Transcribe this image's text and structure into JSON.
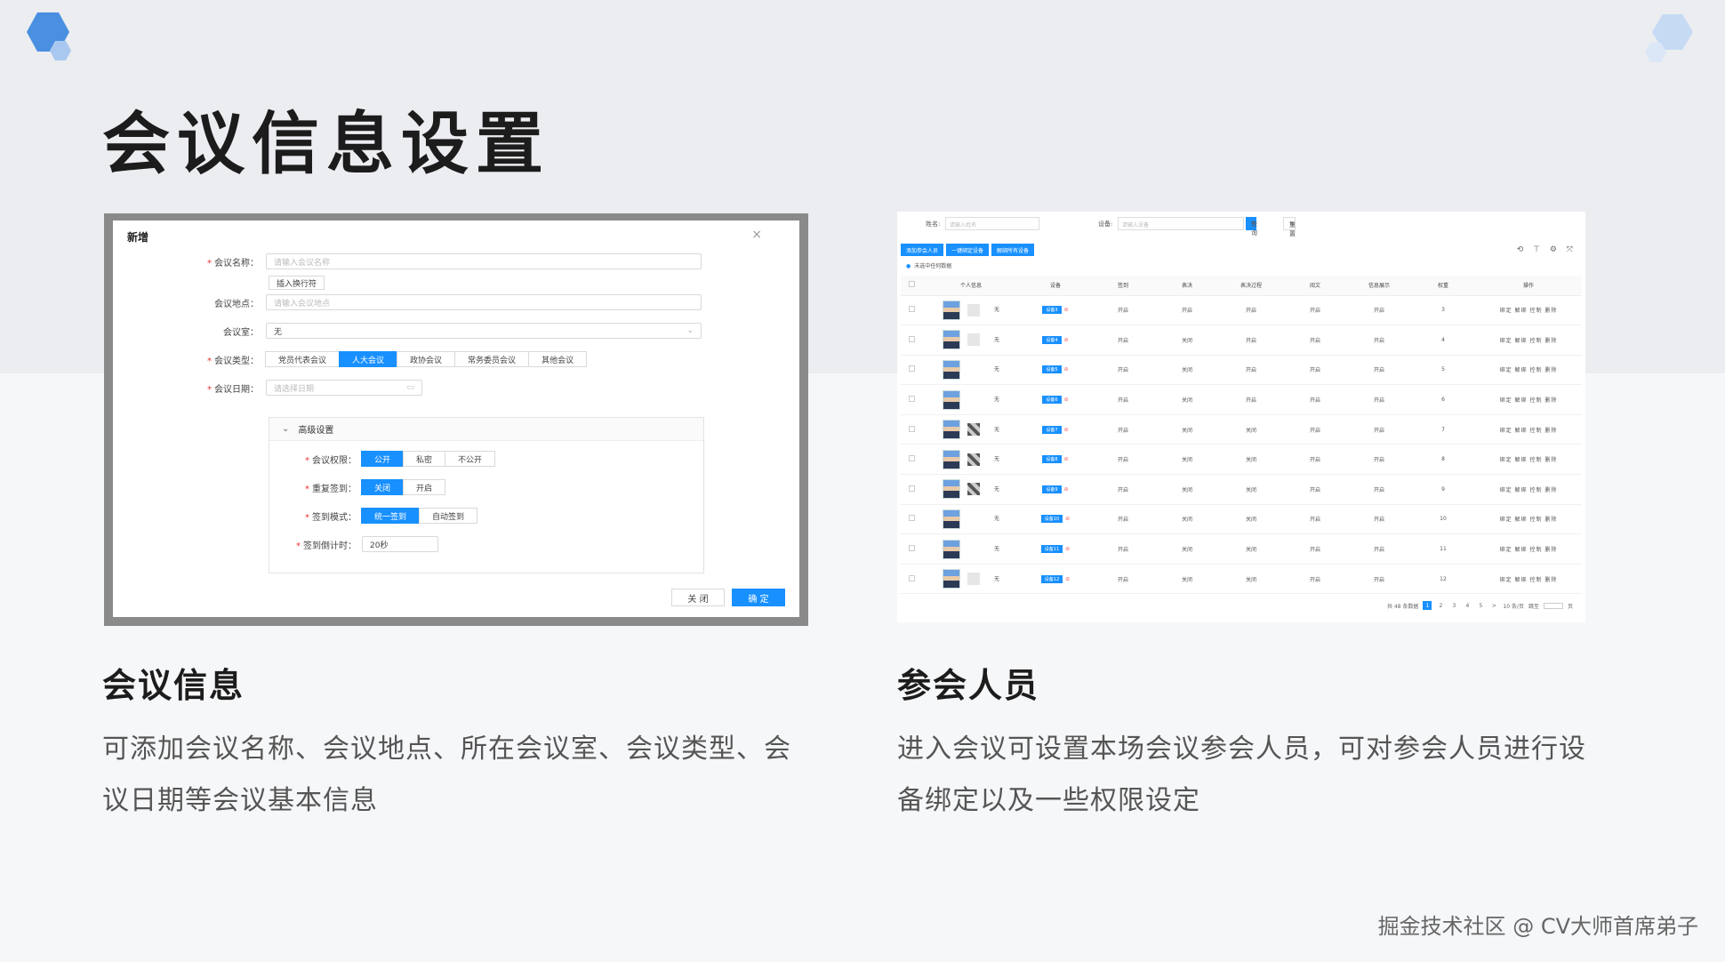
{
  "slide": {
    "title": "会议信息设置",
    "watermark": "掘金技术社区 @ CV大师首席弟子",
    "accent_color": "#4a8fe0"
  },
  "sections": [
    {
      "title": "会议信息",
      "description_line1": "可添加会议名称、会议地点、所在会议室、会议类型、会",
      "description_line2": "议日期等会议基本信息"
    },
    {
      "title": "参会人员",
      "description_line1": "进入会议可设置本场会议参会人员，可对参会人员进行设",
      "description_line2": "备绑定以及一些权限设定"
    }
  ],
  "dialog": {
    "title": "新增",
    "close_icon": "×",
    "name_label": "会议名称：",
    "name_placeholder": "请输入会议名称",
    "insert_newline": "插入换行符",
    "location_label": "会议地点：",
    "location_placeholder": "请输入会议地点",
    "room_label": "会议室：",
    "room_value": "无",
    "type_label": "会议类型：",
    "types": [
      "党员代表会议",
      "人大会议",
      "政协会议",
      "常务委员会议",
      "其他会议"
    ],
    "date_label": "会议日期：",
    "date_placeholder": "请选择日期",
    "advanced_label": "高级设置",
    "permission_label": "会议权限：",
    "permissions": [
      "公开",
      "私密",
      "不公开"
    ],
    "repeat_label": "重复签到：",
    "repeat_options": [
      "关闭",
      "开启"
    ],
    "signin_mode_label": "签到模式：",
    "signin_modes": [
      "统一签到",
      "自动签到"
    ],
    "countdown_label": "签到倒计时：",
    "countdown_value": "20秒",
    "cancel_label": "关 闭",
    "ok_label": "确 定"
  },
  "attendees": {
    "name_label": "姓名:",
    "name_placeholder": "请输入姓名",
    "device_label": "设备:",
    "device_placeholder": "请输入设备",
    "query_label": "查询",
    "reset_label": "重置",
    "toolbar": [
      "添加参会人员",
      "一键绑定设备",
      "解绑所有设备"
    ],
    "tools": "⟲ ⊤ ⚙ ⤧",
    "alert": "未选中任何数据",
    "columns": [
      "",
      "个人信息",
      "设备",
      "签到",
      "表决",
      "表决过程",
      "阅文",
      "信息展示",
      "权重",
      "操作"
    ],
    "rows": [
      {
        "qr": "light",
        "name": "无",
        "device": "设备3",
        "sign": "开启",
        "vote": "开启",
        "process": "开启",
        "read": "开启",
        "info": "开启",
        "weight": "3",
        "ops": "绑定 解绑 控制 删除"
      },
      {
        "qr": "light",
        "name": "无",
        "device": "设备4",
        "sign": "开启",
        "vote": "关闭",
        "process": "开启",
        "read": "开启",
        "info": "开启",
        "weight": "4",
        "ops": "绑定 解绑 控制 删除"
      },
      {
        "qr": "none",
        "name": "无",
        "device": "设备5",
        "sign": "开启",
        "vote": "关闭",
        "process": "开启",
        "read": "开启",
        "info": "开启",
        "weight": "5",
        "ops": "绑定 解绑 控制 删除"
      },
      {
        "qr": "none",
        "name": "无",
        "device": "设备6",
        "sign": "开启",
        "vote": "关闭",
        "process": "开启",
        "read": "开启",
        "info": "开启",
        "weight": "6",
        "ops": "绑定 解绑 控制 删除"
      },
      {
        "qr": "dark",
        "name": "无",
        "device": "设备7",
        "sign": "开启",
        "vote": "关闭",
        "process": "关闭",
        "read": "开启",
        "info": "开启",
        "weight": "7",
        "ops": "绑定 解绑 控制 删除"
      },
      {
        "qr": "dark",
        "name": "无",
        "device": "设备8",
        "sign": "开启",
        "vote": "关闭",
        "process": "关闭",
        "read": "开启",
        "info": "开启",
        "weight": "8",
        "ops": "绑定 解绑 控制 删除"
      },
      {
        "qr": "dark",
        "name": "无",
        "device": "设备9",
        "sign": "开启",
        "vote": "关闭",
        "process": "关闭",
        "read": "开启",
        "info": "开启",
        "weight": "9",
        "ops": "绑定 解绑 控制 删除"
      },
      {
        "qr": "none",
        "name": "无",
        "device": "设备10",
        "sign": "开启",
        "vote": "关闭",
        "process": "关闭",
        "read": "开启",
        "info": "开启",
        "weight": "10",
        "ops": "绑定 解绑 控制 删除"
      },
      {
        "qr": "none",
        "name": "无",
        "device": "设备11",
        "sign": "开启",
        "vote": "关闭",
        "process": "关闭",
        "read": "开启",
        "info": "开启",
        "weight": "11",
        "ops": "绑定 解绑 控制 删除"
      },
      {
        "qr": "light",
        "name": "无",
        "device": "设备12",
        "sign": "开启",
        "vote": "关闭",
        "process": "关闭",
        "read": "开启",
        "info": "开启",
        "weight": "12",
        "ops": "绑定 解绑 控制 删除"
      }
    ],
    "pager_total": "共 48 条数据",
    "pages": [
      "1",
      "2",
      "3",
      "4",
      "5",
      ">"
    ],
    "page_size": "10 条/页",
    "jump_label": "跳至",
    "page_unit": "页"
  }
}
